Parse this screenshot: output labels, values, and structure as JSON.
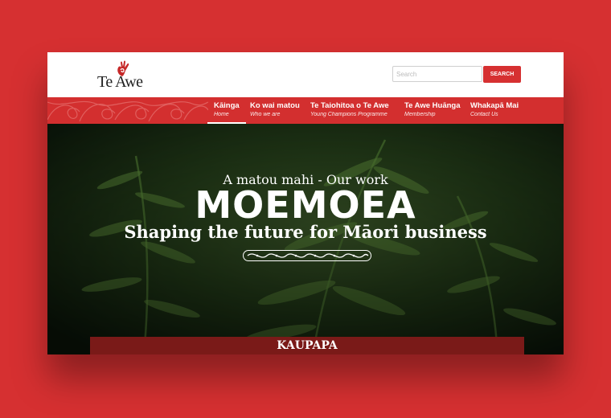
{
  "header": {
    "logo_text": "Te Awe",
    "search": {
      "placeholder": "Search",
      "button_label": "SEARCH"
    }
  },
  "nav": {
    "items": [
      {
        "label": "Kāinga",
        "sub": "Home",
        "active": true
      },
      {
        "label": "Ko wai matou",
        "sub": "Who we are"
      },
      {
        "label": "Te Taiohitoa o Te Awe",
        "sub": "Young Champions Programme"
      },
      {
        "label": "Te Awe Huānga",
        "sub": "Membership"
      },
      {
        "label": "Whakapā Mai",
        "sub": "Contact Us"
      }
    ]
  },
  "hero": {
    "kicker": "A matou mahi - Our work",
    "title": "MOEMOEA",
    "subtitle": "Shaping the future for Māori business",
    "tab_label": "KAUPAPA"
  },
  "colors": {
    "brand_red": "#d63031",
    "nav_red": "#d32f2f",
    "dark_tab": "#7a1a18"
  }
}
